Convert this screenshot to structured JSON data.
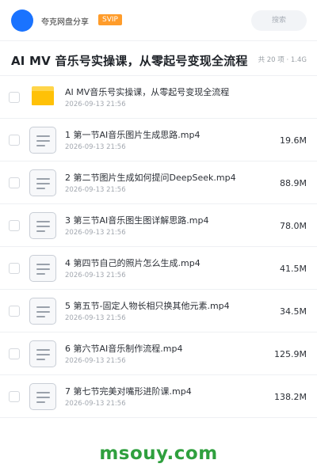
{
  "header": {
    "brand": "夸克网盘分享",
    "badge": "SVIP",
    "search_label": "搜索"
  },
  "title_bar": {
    "title": "AI MV 音乐号实操课，从零起号变现全流程",
    "meta": "共 20 项 · 1.4G"
  },
  "items": [
    {
      "name": "AI MV音乐号实操课，从零起号变现全流程",
      "date": "2026-09-13 21:56",
      "size": "",
      "type": "folder",
      "icon": "folder-icon"
    },
    {
      "name": "1 第一节AI音乐图片生成思路.mp4",
      "date": "2026-09-13 21:56",
      "size": "19.6M",
      "type": "file",
      "icon": "file-icon"
    },
    {
      "name": "2 第二节图片生成如何提问DeepSeek.mp4",
      "date": "2026-09-13 21:56",
      "size": "88.9M",
      "type": "file",
      "icon": "file-icon"
    },
    {
      "name": "3 第三节AI音乐图生图详解思路.mp4",
      "date": "2026-09-13 21:56",
      "size": "78.0M",
      "type": "file",
      "icon": "file-icon"
    },
    {
      "name": "4 第四节自己的照片怎么生成.mp4",
      "date": "2026-09-13 21:56",
      "size": "41.5M",
      "type": "file",
      "icon": "file-icon"
    },
    {
      "name": "5 第五节-固定人物长相只换其他元素.mp4",
      "date": "2026-09-13 21:56",
      "size": "34.5M",
      "type": "file",
      "icon": "file-icon"
    },
    {
      "name": "6 第六节AI音乐制作流程.mp4",
      "date": "2026-09-13 21:56",
      "size": "125.9M",
      "type": "file",
      "icon": "file-icon"
    },
    {
      "name": "7 第七节完美对嘴形进阶课.mp4",
      "date": "2026-09-13 21:56",
      "size": "138.2M",
      "type": "file",
      "icon": "file-icon"
    }
  ],
  "watermark": "msouy.com",
  "colors": {
    "accent": "#1a73ff",
    "svip": "#ff9c2a",
    "folder": "#ffc107",
    "watermark": "#2fa03e"
  }
}
